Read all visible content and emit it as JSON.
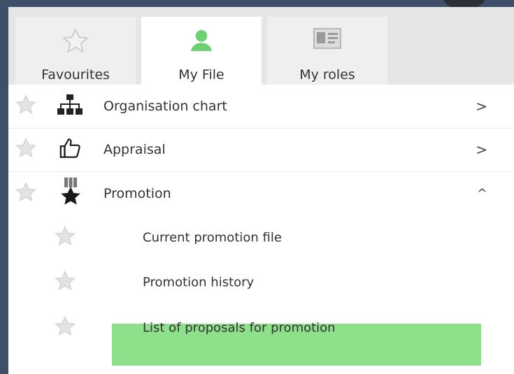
{
  "tabs": [
    {
      "label": "Favourites",
      "icon": "star-outline-icon",
      "active": false
    },
    {
      "label": "My File",
      "icon": "person-icon",
      "active": true
    },
    {
      "label": "My roles",
      "icon": "id-card-icon",
      "active": false
    }
  ],
  "menu": [
    {
      "label": "Organisation chart",
      "icon": "org-chart-icon",
      "chevron": ">",
      "expanded": false
    },
    {
      "label": "Appraisal",
      "icon": "thumbs-up-icon",
      "chevron": ">",
      "expanded": false
    },
    {
      "label": "Promotion",
      "icon": "medal-icon",
      "chevron": "^",
      "expanded": true,
      "children": [
        {
          "label": "Current promotion file"
        },
        {
          "label": "Promotion history"
        },
        {
          "label": "List of proposals for promotion",
          "selected": true
        }
      ]
    }
  ],
  "colors": {
    "frame": "#3e4f6a",
    "tab_bar": "#e6e6e6",
    "active_tab": "#ffffff",
    "person_icon": "#6fcf73",
    "selected_row": "#8ee08a",
    "star": "#d9d9d9"
  }
}
